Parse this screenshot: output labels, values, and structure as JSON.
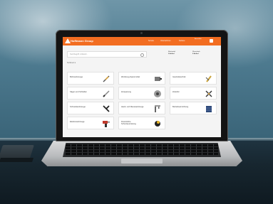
{
  "site": {
    "brand": "Hoffmann Group",
    "brand_color": "#f26d21",
    "nav": [
      "Service",
      "Unternehmen",
      "Karriere"
    ],
    "login": "Anmelden"
  },
  "search": {
    "placeholder": "Suchbegriff, Artikelnr."
  },
  "header_boxes": [
    {
      "label": "Merkzettel",
      "value": "0 Artikel"
    },
    {
      "label": "Warenkorb",
      "value": "0 Artikel"
    }
  ],
  "breadcrumb": "Sortiment",
  "categories": [
    {
      "label": "Bohrwerkzeuge",
      "icon": "drill-bit-icon"
    },
    {
      "label": "Werkzeug-Spannmittel",
      "icon": "chuck-icon"
    },
    {
      "label": "Gewindetechnik",
      "icon": "tap-icon"
    },
    {
      "label": "Sägen und Schleifen",
      "icon": "saw-blade-icon"
    },
    {
      "label": "Zerspanung",
      "icon": "milling-cutter-icon"
    },
    {
      "label": "Zubehör",
      "icon": "disc-icon"
    },
    {
      "label": "Schneidwerkzeuge",
      "icon": "pliers-icon"
    },
    {
      "label": "Hand- und Messwerkzeuge",
      "icon": "vernier-caliper-icon"
    },
    {
      "label": "Betriebseinrichtung",
      "icon": "cabinet-icon"
    },
    {
      "label": "Elektrowerkzeuge",
      "icon": "power-drill-icon"
    },
    {
      "label": "Persönliche Schutzausrüstung",
      "icon": "gloves-icon"
    }
  ]
}
